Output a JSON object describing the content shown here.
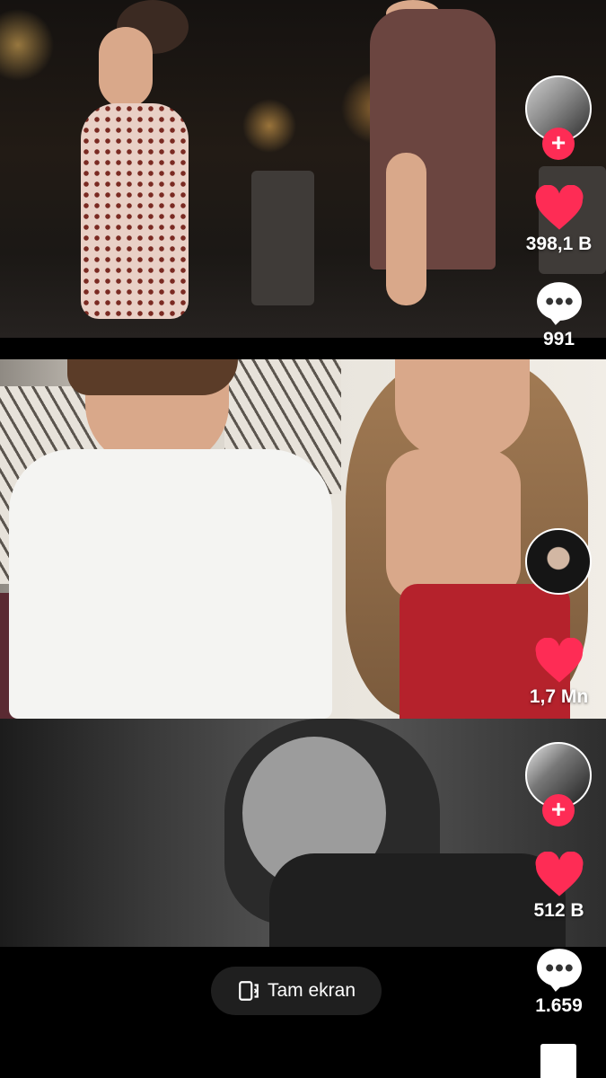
{
  "feed": {
    "videos": [
      {
        "avatar": "avatar-couple",
        "has_follow": true,
        "likes": "398,1 B",
        "comments": "991"
      },
      {
        "avatar": "avatar-woman",
        "has_follow": false,
        "likes": "1,7 Mn",
        "comments": ""
      },
      {
        "avatar": "avatar-grayscale",
        "has_follow": true,
        "likes": "512 B",
        "comments": "1.659"
      }
    ]
  },
  "controls": {
    "fullscreen_label": "Tam ekran",
    "follow_symbol": "+"
  },
  "colors": {
    "like_red": "#fe2c55",
    "follow_red": "#fe2c55",
    "button_bg": "#1f1f1f"
  },
  "icons": [
    "heart-icon",
    "comment-icon",
    "follow-plus-icon",
    "fullscreen-icon",
    "bookmark-icon"
  ]
}
